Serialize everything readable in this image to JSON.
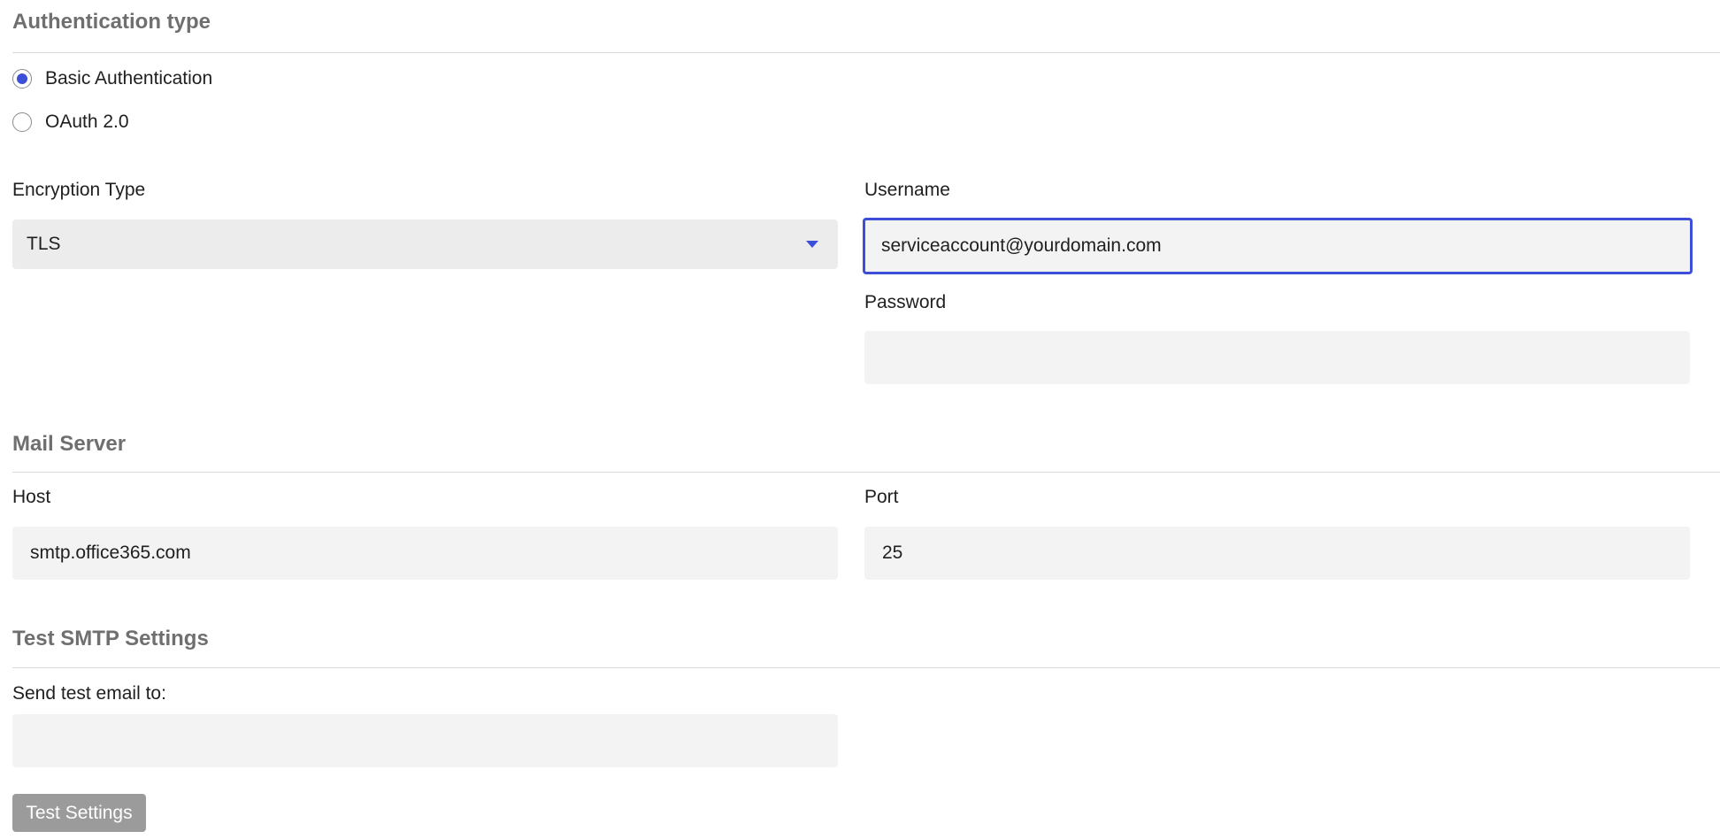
{
  "auth_section": {
    "title": "Authentication type",
    "options": [
      {
        "label": "Basic Authentication",
        "selected": true
      },
      {
        "label": "OAuth 2.0",
        "selected": false
      }
    ]
  },
  "encryption": {
    "label": "Encryption Type",
    "value": "TLS"
  },
  "username": {
    "label": "Username",
    "value": "serviceaccount@yourdomain.com"
  },
  "password": {
    "label": "Password",
    "value": ""
  },
  "mail_server": {
    "title": "Mail Server",
    "host_label": "Host",
    "host_value": "smtp.office365.com",
    "port_label": "Port",
    "port_value": "25"
  },
  "test_section": {
    "title": "Test SMTP Settings",
    "send_label": "Send test email to:",
    "send_value": "",
    "button_label": "Test Settings"
  },
  "colors": {
    "accent": "#3d4ed8",
    "input_bg": "#f3f3f3",
    "button_bg": "#9b9b9b"
  }
}
